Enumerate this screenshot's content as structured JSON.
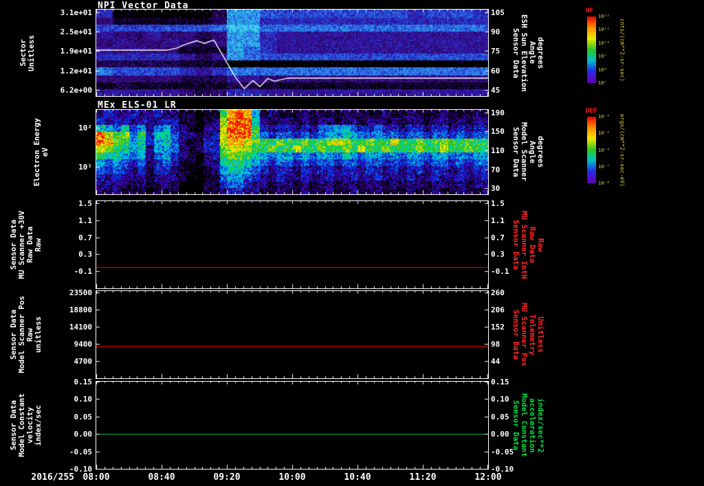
{
  "window": {
    "background": "#000000"
  },
  "x_axis": {
    "date_label": "2016/255",
    "tick_labels": [
      "08:00",
      "08:40",
      "09:20",
      "10:00",
      "10:40",
      "11:20",
      "12:00"
    ],
    "start_hour": 8,
    "end_hour": 12
  },
  "chart_data": [
    {
      "id": "npi",
      "type": "heatmap",
      "title": "NPI Vector Data",
      "left_axis": {
        "label_lines": [
          "Sector",
          "Unitless"
        ],
        "tick_labels": [
          "3.1e+01",
          "2.5e+01",
          "1.9e+01",
          "1.2e+01",
          "6.2e+00"
        ]
      },
      "right_axis": {
        "label_lines": [
          "Sensor Data",
          "ESH Sun Elevation",
          "Angle",
          "degrees"
        ],
        "tick_labels": [
          "105",
          "90",
          "75",
          "60",
          "45"
        ],
        "color": "#ffffff",
        "range": [
          107,
          43
        ]
      },
      "colorbar": {
        "name": "NF",
        "unit": "cnts/(cm**2-sr-sec)",
        "tick_labels": [
          "10¹²",
          "10¹¹",
          "10¹⁰",
          "10⁹",
          "10⁸",
          "10⁷"
        ]
      },
      "palette": [
        "#000000",
        "#16013f",
        "#270763",
        "#3b0c86",
        "#2e18a6",
        "#2334c4",
        "#2a55dd",
        "#2f7de9",
        "#28aae2",
        "#40d3eb"
      ],
      "grid": [
        "500000028866666666656665",
        "311111128855555555555555",
        "666666679977777777777777",
        "433433238854444444444444",
        "343343238854444444444444",
        "434331118754444444444444",
        "555554248766666666666666",
        "222221110000000000000000",
        "766665457777777777777777",
        "333332224433333333333333",
        "121111112211111111111111",
        "444443235544444444444444"
      ],
      "overlay_line": {
        "name": "sun-elevation-angle-trace",
        "color": "#ffffff",
        "units": "degrees",
        "points": [
          [
            8.0,
            77
          ],
          [
            8.72,
            77
          ],
          [
            8.82,
            78.5
          ],
          [
            8.92,
            81.5
          ],
          [
            9.03,
            84
          ],
          [
            9.1,
            82
          ],
          [
            9.2,
            84.5
          ],
          [
            9.3,
            72
          ],
          [
            9.42,
            57
          ],
          [
            9.51,
            48.5
          ],
          [
            9.6,
            54.5
          ],
          [
            9.67,
            50
          ],
          [
            9.75,
            56
          ],
          [
            9.82,
            54
          ],
          [
            9.95,
            56.3
          ],
          [
            12.0,
            56.3
          ]
        ]
      }
    },
    {
      "id": "els",
      "type": "heatmap",
      "title": "MEx ELS-01 LR",
      "left_axis": {
        "label_lines": [
          "Electron Energy",
          "eV"
        ],
        "log_ticks": [
          {
            "label": "10²",
            "frac": 0.211
          },
          {
            "label": "10¹",
            "frac": 0.675
          }
        ]
      },
      "right_axis": {
        "label_lines": [
          "Sensor Data",
          "Model Scanner",
          "Angle",
          "degrees"
        ],
        "tick_labels": [
          "190",
          "150",
          "110",
          "70",
          "30"
        ],
        "color": "#ffffff"
      },
      "colorbar": {
        "name": "DEF",
        "unit": "ergs/(cm**2-sr-sec-eV)",
        "tick_labels": [
          "10⁻⁴",
          "10⁻⁵",
          "10⁻⁶",
          "10⁻⁷",
          "10⁻⁸"
        ]
      },
      "palette": [
        "#000000",
        "#1c0055",
        "#3404a6",
        "#0a2cd2",
        "#0a75e6",
        "#00bede",
        "#00d68a",
        "#2cc62c",
        "#abd600",
        "#eee600",
        "#f49600",
        "#f01e00"
      ],
      "grid": [
        "2322322322110117aba51211121111211112112111211121",
        "3233232233110128bbb62122121221221221212212212122",
        "6546352453210229bbb73233232445543343323323323233",
        "b978473664221239bbb74344343455654454434434434344",
        "ba87563564211339aa987787787789877877977877877877",
        "987656255421133899877877977877879778777877977877",
        "766545245321023788765455454554654554545545545455",
        "545434234311022677654344343443443443434434434344",
        "434323133210012566543233232332332332323323323233",
        "323222122210011455432232232232232232223223223223",
        "222212112100011344322122121221221221212212212122",
        "212111011100011233221121121121121121112112112112"
      ]
    },
    {
      "id": "mu30v",
      "type": "line",
      "left_axis": {
        "label_lines": [
          "Sensor Data",
          "MU Scanner +30V",
          "Raw Data",
          "Raw"
        ],
        "tick_labels": [
          "1.5",
          "1.1",
          "0.7",
          "0.3",
          "-0.1"
        ],
        "tick_values": [
          1.5,
          1.1,
          0.7,
          0.3,
          -0.1
        ],
        "range": [
          1.55,
          -0.5
        ]
      },
      "right_axis": {
        "label_lines": [
          "Sensor Data",
          "MU Scanner IntH",
          "Raw Data",
          "Raw"
        ],
        "tick_labels": [
          "1.5",
          "1.1",
          "0.7",
          "0.3",
          "-0.1"
        ],
        "color": "#ff2a2a"
      },
      "series": [
        {
          "name": "MU Scanner +30V Raw Data",
          "color": "#ff0000",
          "value": 0.0
        }
      ]
    },
    {
      "id": "scanpos",
      "type": "line",
      "left_axis": {
        "label_lines": [
          "Sensor Data",
          "Model Scanner Pos",
          "Raw",
          "unitless"
        ],
        "tick_labels": [
          "23500",
          "18800",
          "14100",
          "9400",
          "4700"
        ],
        "tick_values": [
          23500,
          18800,
          14100,
          9400,
          4700
        ],
        "range": [
          23900,
          0
        ]
      },
      "right_axis": {
        "label_lines": [
          "Sensor Data",
          "MU Scanner Pos",
          "Telemetry",
          "Unitless"
        ],
        "tick_labels": [
          "260",
          "206",
          "152",
          "98",
          "44"
        ],
        "color": "#ff2a2a"
      },
      "series": [
        {
          "name": "Model Scanner Pos Raw",
          "color": "#ff0000",
          "value": 8800
        }
      ]
    },
    {
      "id": "modelconst",
      "type": "line",
      "left_axis": {
        "label_lines": [
          "Sensor Data",
          "Model Constant",
          "velocity",
          "index/sec"
        ],
        "tick_labels": [
          "0.15",
          "0.10",
          "0.05",
          "0.00",
          "-0.05",
          "-0.10"
        ],
        "tick_values": [
          0.15,
          0.1,
          0.05,
          0.0,
          -0.05,
          -0.1
        ],
        "range": [
          0.15,
          -0.1
        ]
      },
      "right_axis": {
        "label_lines": [
          "Sensor Data",
          "Model Constant",
          "acceleration",
          "index/sec**2"
        ],
        "tick_labels": [
          "0.15",
          "0.10",
          "0.05",
          "0.00",
          "-0.05",
          "-0.10"
        ],
        "color": "#00dd44"
      },
      "series": [
        {
          "name": "Model Constant velocity",
          "color": "#00cc44",
          "value": 0.0
        }
      ]
    }
  ]
}
